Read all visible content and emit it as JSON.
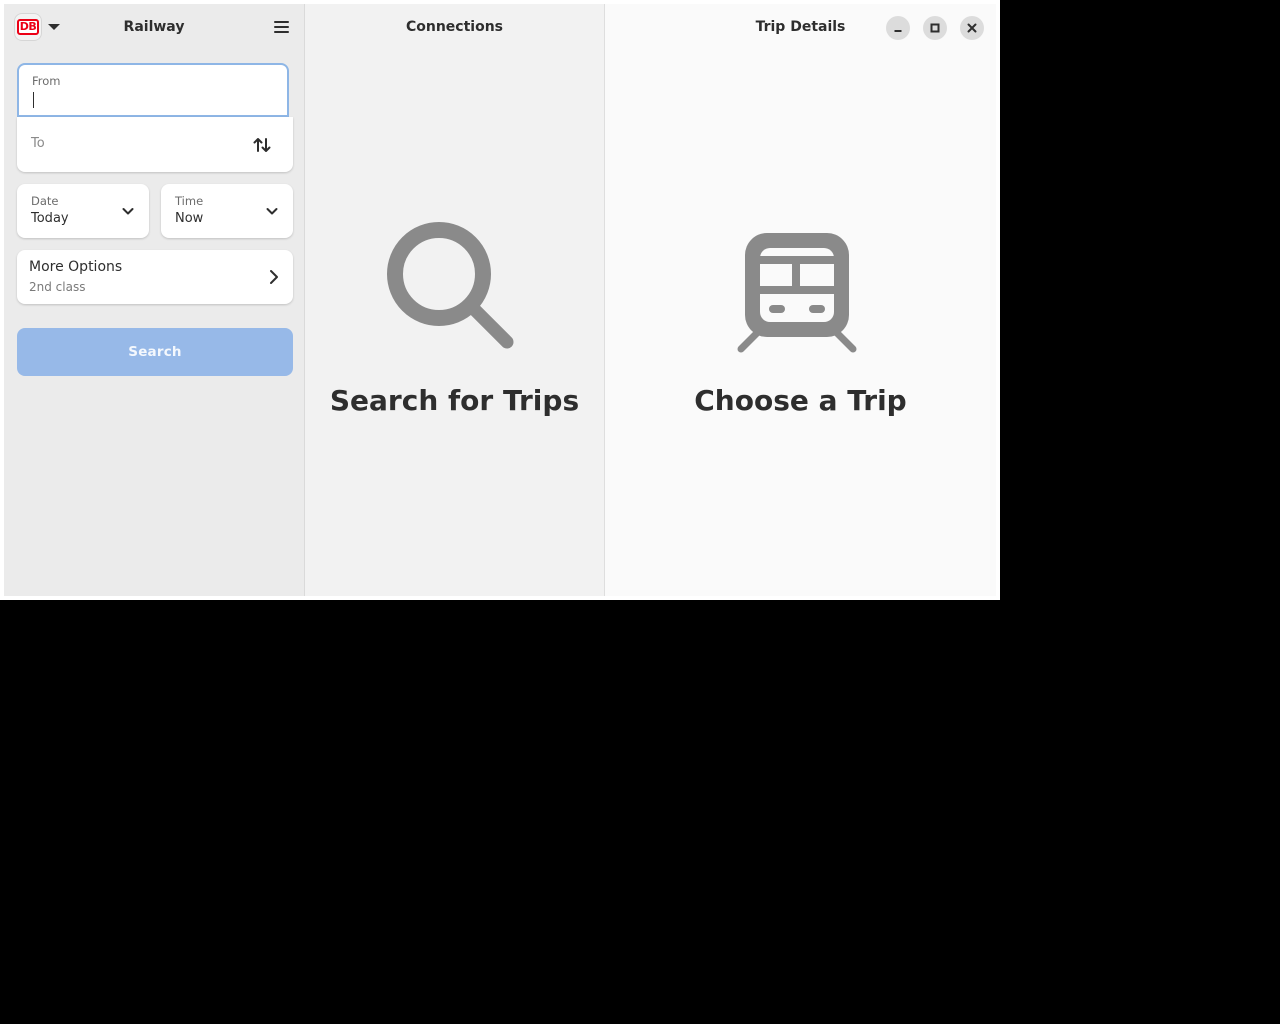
{
  "sidebar": {
    "title": "Railway",
    "provider_logo_text": "DB",
    "from": {
      "label": "From",
      "value": ""
    },
    "to": {
      "placeholder": "To"
    },
    "date": {
      "label": "Date",
      "value": "Today"
    },
    "time": {
      "label": "Time",
      "value": "Now"
    },
    "more_options": {
      "title": "More Options",
      "subtitle": "2nd class"
    },
    "search_label": "Search"
  },
  "connections": {
    "title": "Connections",
    "status_title": "Search for Trips"
  },
  "trip_details": {
    "title": "Trip Details",
    "status_title": "Choose a Trip"
  },
  "colors": {
    "accent": "#8eb6e6",
    "search_button": "#97b9e8",
    "db_red": "#ec0016",
    "icon_grey": "#8a8a8a"
  },
  "icons": [
    "db-logo",
    "chevron-down-icon",
    "menu-icon",
    "swap-icon",
    "chevron-right-icon",
    "search-icon",
    "train-icon",
    "minimize-icon",
    "maximize-icon",
    "close-icon"
  ]
}
